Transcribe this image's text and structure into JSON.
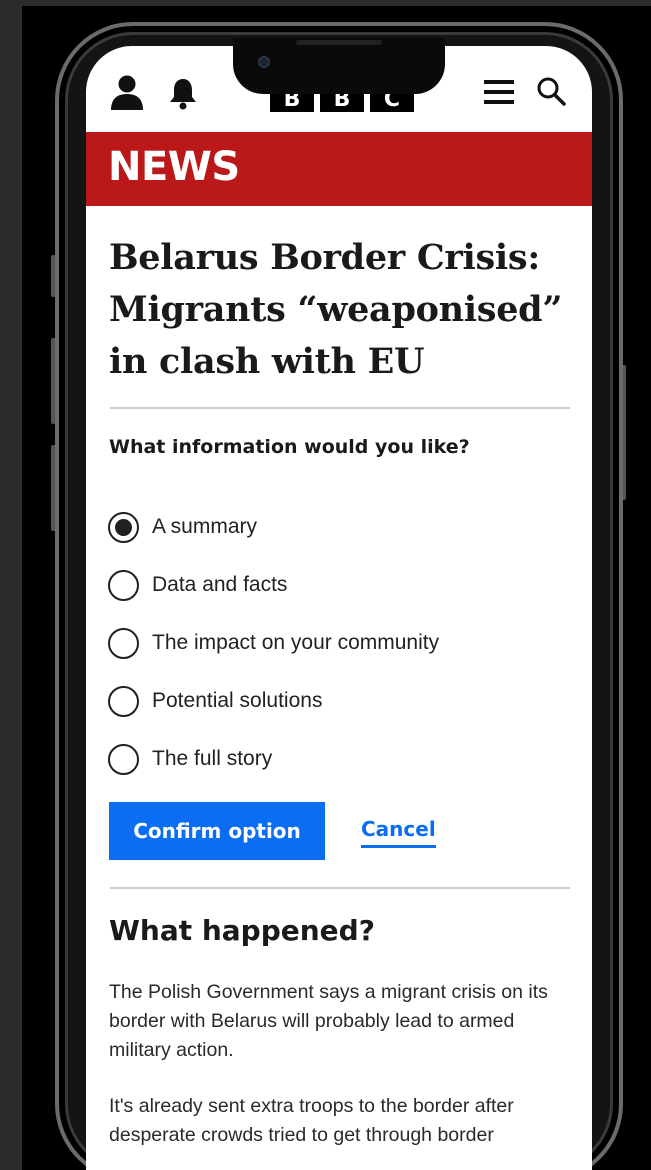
{
  "header": {
    "logo_letters": [
      "B",
      "B",
      "C"
    ],
    "icons": {
      "account": "person-icon",
      "notifications": "bell-icon",
      "menu": "hamburger-menu-icon",
      "search": "search-icon"
    }
  },
  "section_label": "NEWS",
  "article": {
    "headline_lines": [
      "Belarus Border Crisis:",
      "Migrants “weaponised”",
      "in clash with EU"
    ]
  },
  "poll": {
    "question": "What information would you like?",
    "options": [
      {
        "label": "A summary",
        "selected": true
      },
      {
        "label": "Data and facts",
        "selected": false
      },
      {
        "label": "The impact on your community",
        "selected": false
      },
      {
        "label": "Potential solutions",
        "selected": false
      },
      {
        "label": "The full story",
        "selected": false
      }
    ],
    "confirm_label": "Confirm option",
    "cancel_label": "Cancel"
  },
  "what_happened": {
    "heading": "What happened?",
    "paragraphs": [
      "The Polish Government says a migrant crisis on its border with Belarus will probably lead to armed military action.",
      "It's already sent extra troops to the border after desperate crowds tried to get through border"
    ]
  },
  "colors": {
    "news_red": "#bb1919",
    "link_blue": "#0b6ef2",
    "text": "#1a1a1a"
  }
}
